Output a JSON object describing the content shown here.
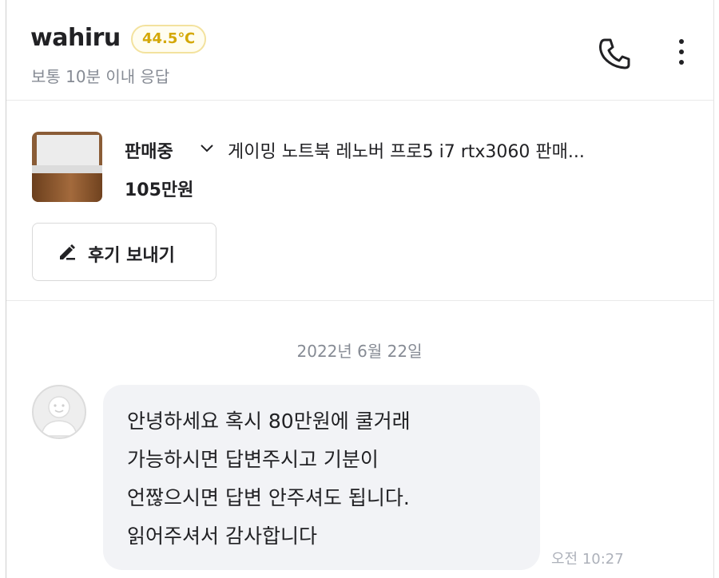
{
  "header": {
    "username": "wahiru",
    "temperature": "44.5℃",
    "response_time": "보통 10분 이내 응답",
    "icons": [
      "phone-icon",
      "more-vertical-icon"
    ]
  },
  "product": {
    "status": "판매중",
    "title": "게이밍 노트북 레노버 프로5 i7 rtx3060 판매...",
    "price": "105만원",
    "review_button": "후기 보내기"
  },
  "chat": {
    "date": "2022년 6월 22일",
    "message_lines": [
      "안녕하세요 혹시 80만원에 쿨거래",
      "가능하시면 답변주시고 기분이",
      "언짢으시면 답변 안주셔도 됩니다.",
      "읽어주셔서 감사합니다"
    ],
    "time": "오전 10:27"
  },
  "colors": {
    "temperature_accent": "#d4a808",
    "secondary_text": "#868b94",
    "bubble_bg": "#f2f3f6"
  }
}
